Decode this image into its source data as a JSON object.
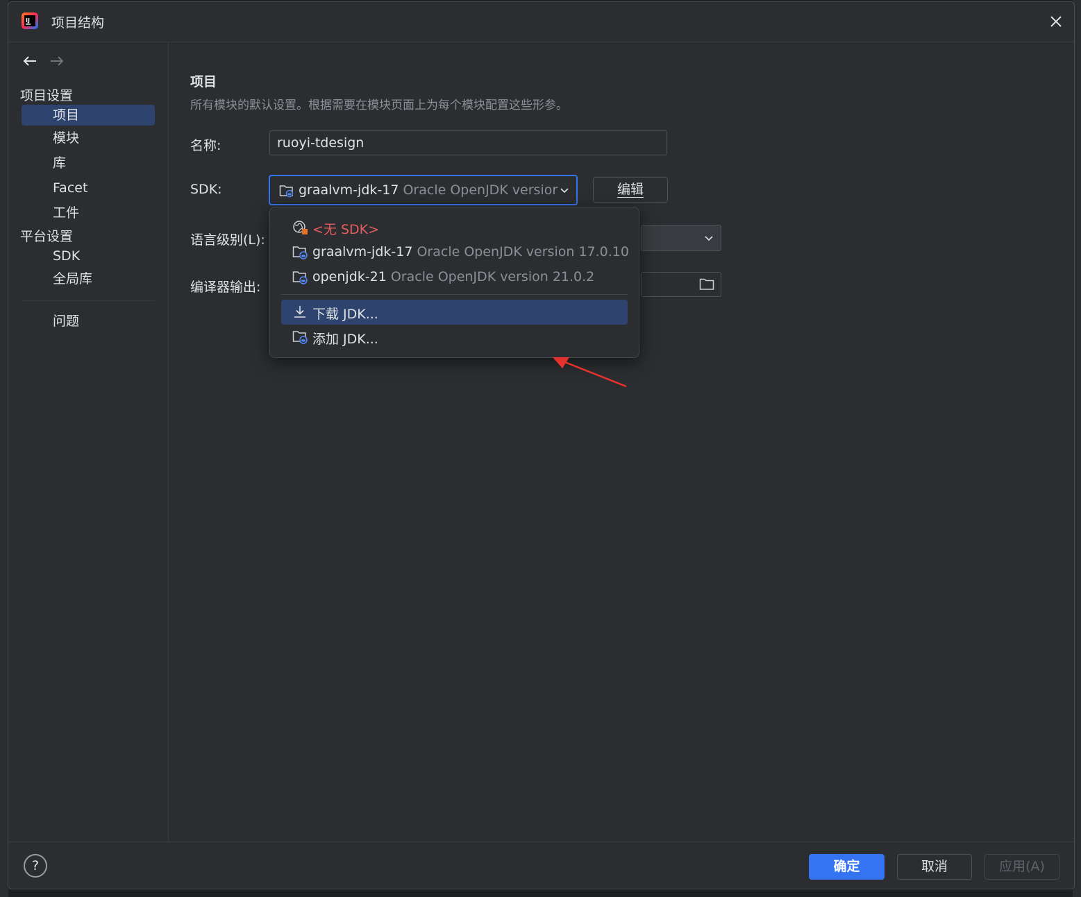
{
  "window": {
    "title": "项目结构",
    "close_icon": "close-icon",
    "app_icon": "intellij-idea-icon"
  },
  "sidebar": {
    "back_icon": "arrow-left-icon",
    "forward_icon": "arrow-right-icon",
    "project_settings_header": "项目设置",
    "project_items": [
      "项目",
      "模块",
      "库",
      "Facet",
      "工件"
    ],
    "selected_item": "项目",
    "platform_settings_header": "平台设置",
    "platform_items": [
      "SDK",
      "全局库"
    ],
    "problems_item": "问题"
  },
  "main": {
    "heading": "项目",
    "description": "所有模块的默认设置。根据需要在模块页面上为每个模块配置这些形参。",
    "name_label": "名称:",
    "name_value": "ruoyi-tdesign",
    "sdk_label": "SDK:",
    "sdk_selected_name": "graalvm-jdk-17",
    "sdk_selected_version": "Oracle OpenJDK versior",
    "edit_button": "编辑",
    "language_level_label": "语言级别(L):",
    "compiler_output_label": "编译器输出:"
  },
  "sdk_dropdown": {
    "items": [
      {
        "name": "<无 SDK>",
        "version": "",
        "icon": "no-sdk-icon"
      },
      {
        "name": "graalvm-jdk-17",
        "version": "Oracle OpenJDK version 17.0.10",
        "icon": "jdk-folder-icon"
      },
      {
        "name": "openjdk-21",
        "version": "Oracle OpenJDK version 21.0.2",
        "icon": "jdk-folder-icon"
      }
    ],
    "actions": [
      {
        "label": "下载 JDK...",
        "icon": "download-icon",
        "highlighted": true
      },
      {
        "label": "添加 JDK...",
        "icon": "jdk-folder-icon",
        "highlighted": false
      }
    ]
  },
  "footer": {
    "help": "?",
    "ok": "确定",
    "cancel": "取消",
    "apply": "应用(A)"
  },
  "colors": {
    "accent": "#3574f0",
    "selection": "#2e436e",
    "background": "#2b2d30",
    "error_red": "#e55e5e",
    "annotation_arrow": "#e5322d"
  }
}
